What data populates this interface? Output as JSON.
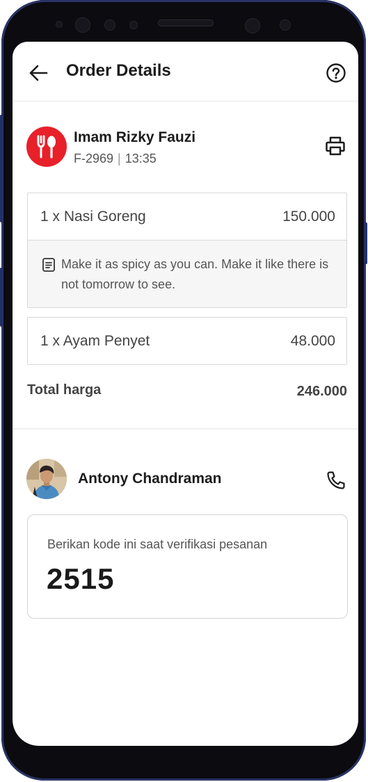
{
  "header": {
    "title": "Order Details",
    "back_icon": "arrow-left-icon",
    "help_icon": "question-circle-icon"
  },
  "restaurant": {
    "name": "Imam Rizky Fauzi",
    "order_id": "F-2969",
    "separator": "|",
    "time": "13:35",
    "logo_icon": "spoon-fork-icon",
    "logo_color": "#e8202a",
    "print_icon": "printer-icon"
  },
  "items": [
    {
      "name": "1 x Nasi Goreng",
      "price": "150.000",
      "note": "Make it as spicy as you can. Make it like there is not tomorrow to see."
    },
    {
      "name": "1 x Ayam Penyet",
      "price": "48.000"
    }
  ],
  "total": {
    "label": "Total harga",
    "value": "246.000"
  },
  "driver": {
    "name": "Antony Chandraman",
    "call_icon": "phone-icon"
  },
  "verification": {
    "caption": "Berikan kode ini saat verifikasi pesanan",
    "code": "2515"
  }
}
